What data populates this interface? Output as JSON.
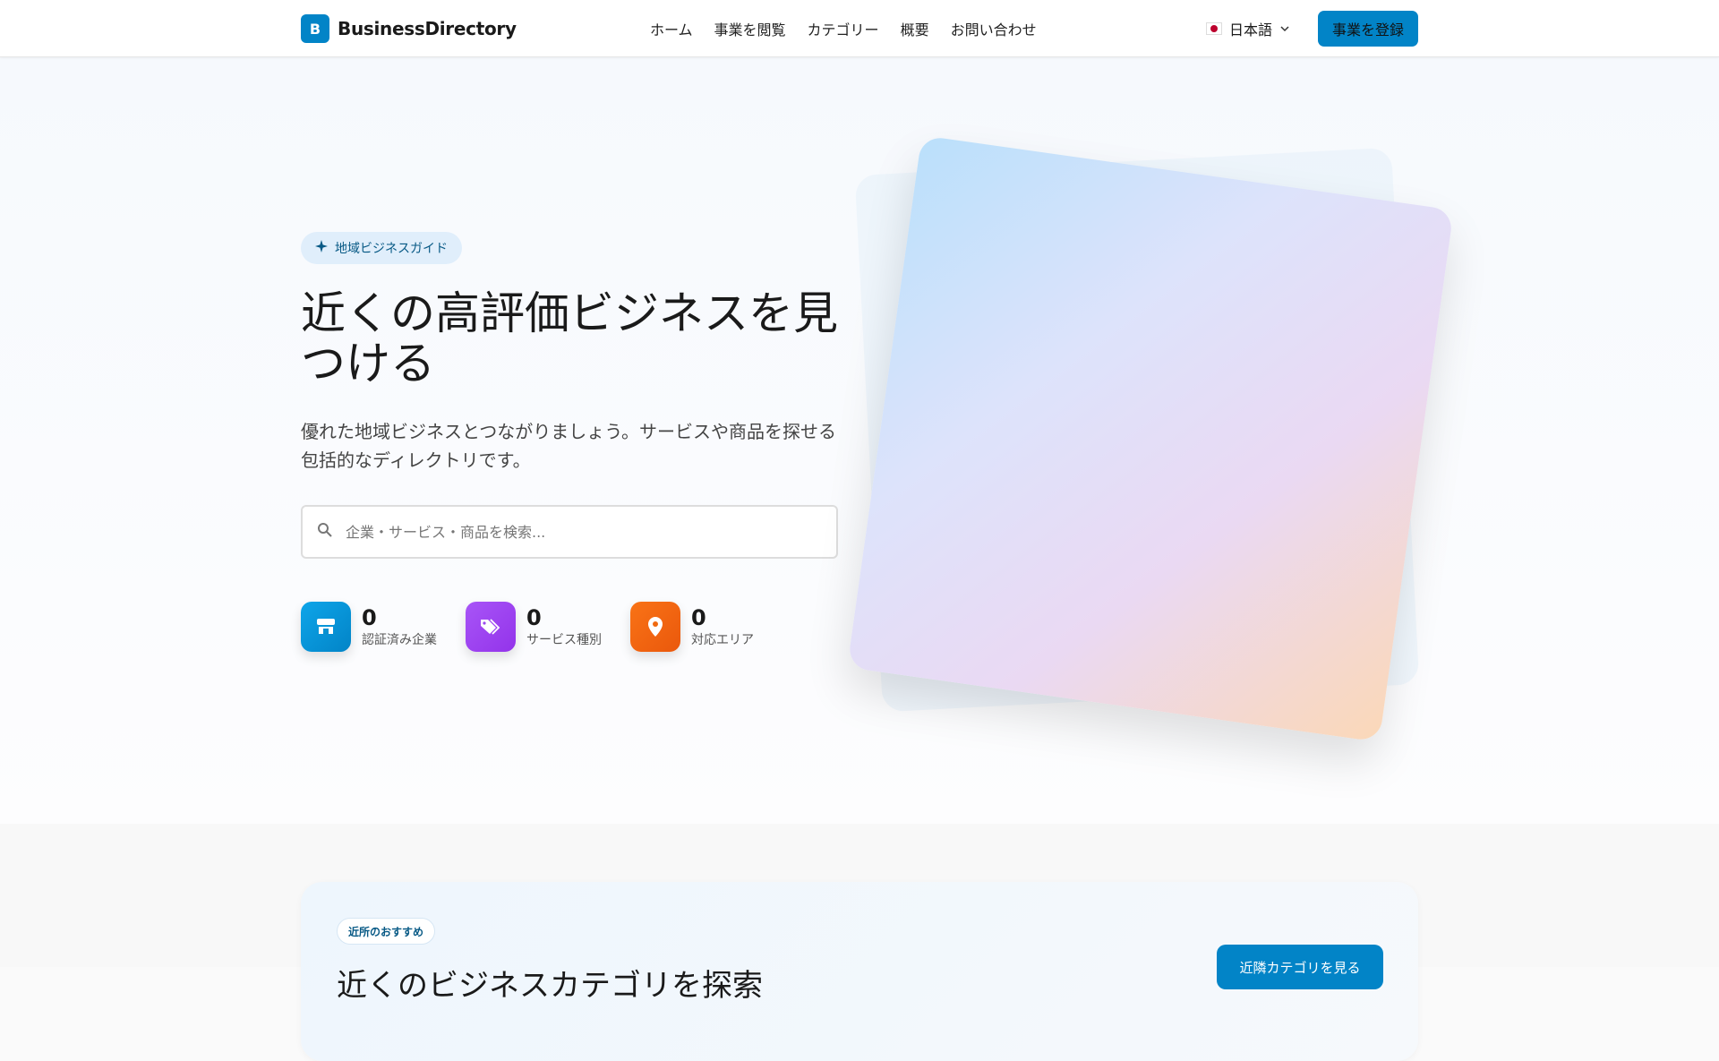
{
  "header": {
    "logo_letter": "B",
    "brand": "BusinessDirectory",
    "nav": [
      "ホーム",
      "事業を閲覧",
      "カテゴリー",
      "概要",
      "お問い合わせ"
    ],
    "language": "日本語",
    "cta": "事業を登録"
  },
  "hero": {
    "badge": "地域ビジネスガイド",
    "title": "近くの高評価ビジネスを見つける",
    "subtitle": "優れた地域ビジネスとつながりましょう。サービスや商品を探せる包括的なディレクトリです。",
    "search_placeholder": "企業・サービス・商品を検索...",
    "stats": [
      {
        "value": "0",
        "label": "認証済み企業",
        "color": "#0284c7"
      },
      {
        "value": "0",
        "label": "サービス種別",
        "color": "#9333ea"
      },
      {
        "value": "0",
        "label": "対応エリア",
        "color": "#ea580c"
      }
    ]
  },
  "nearby": {
    "badge": "近所のおすすめ",
    "title": "近くのビジネスカテゴリを探索",
    "button": "近隣カテゴリを見る"
  }
}
